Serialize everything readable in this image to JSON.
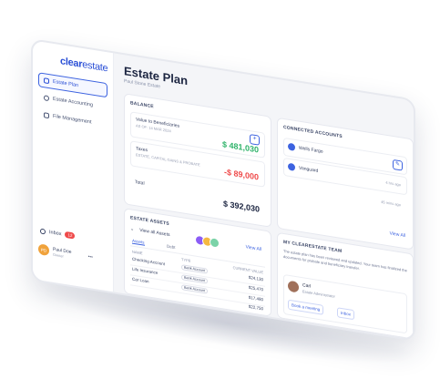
{
  "brand": {
    "logo_main": "clear",
    "logo_accent": "estate",
    "accent": "#3d63e0",
    "green": "#2fb36a",
    "red": "#ef4a4a"
  },
  "sidebar": {
    "items": [
      {
        "label": "Estate Plan",
        "icon": "home-icon",
        "active": true
      },
      {
        "label": "Estate Accounting",
        "icon": "calculator-icon",
        "active": false
      },
      {
        "label": "File Management",
        "icon": "folder-icon",
        "active": false
      }
    ],
    "inbox_label": "Inbox",
    "inbox_count": "12",
    "user_name": "Paul Doe",
    "user_role": "Owner",
    "user_initials": "PD"
  },
  "header": {
    "title": "Estate Plan",
    "subtitle": "Paul Stone Estate"
  },
  "balance": {
    "title": "BALANCE",
    "rows": [
      {
        "label": "Value to Beneficiaries",
        "sub": "AS OF: 14 MAR 2024",
        "value": "$ 481,030",
        "tone": "green"
      },
      {
        "label": "Taxes",
        "sub": "ESTATE, CAPITAL GAINS & PROBATE",
        "value": "-$ 89,000",
        "tone": "red"
      }
    ],
    "total_label": "Total",
    "total_value": "$ 392,030"
  },
  "contacts": {
    "title": "CONNECTED ACCOUNTS",
    "items": [
      {
        "name": "Wells Fargo",
        "time": "4 hrs ago"
      },
      {
        "name": "Vanguard",
        "time": "45 mins ago"
      }
    ],
    "view_all": "View All"
  },
  "assets": {
    "title": "ESTATE ASSETS",
    "filter": "View all Assets",
    "view_all": "View All",
    "tabs": [
      "Assets",
      "Debt"
    ],
    "headers": [
      "NAME",
      "TYPE",
      "CURRENT VALUE"
    ],
    "rows": [
      {
        "name": "Checking Account",
        "type": "Bank Account",
        "value": "$24,130"
      },
      {
        "name": "Life Insurance",
        "type": "Bank Account",
        "value": "$25,470"
      },
      {
        "name": "Car Loan",
        "type": "Bank Account",
        "value": "$17,480"
      },
      {
        "name": "",
        "type": "",
        "value": "$22,750"
      }
    ]
  },
  "advisor": {
    "title": "MY CLEARESTATE TEAM",
    "text": "The estate plan has been reviewed and updated. Your team has finalized the documents for probate and beneficiary transfer.",
    "name": "Carl",
    "role": "Estate Administrator",
    "book_btn": "Book a meeting",
    "inbox_btn": "Inbox"
  }
}
